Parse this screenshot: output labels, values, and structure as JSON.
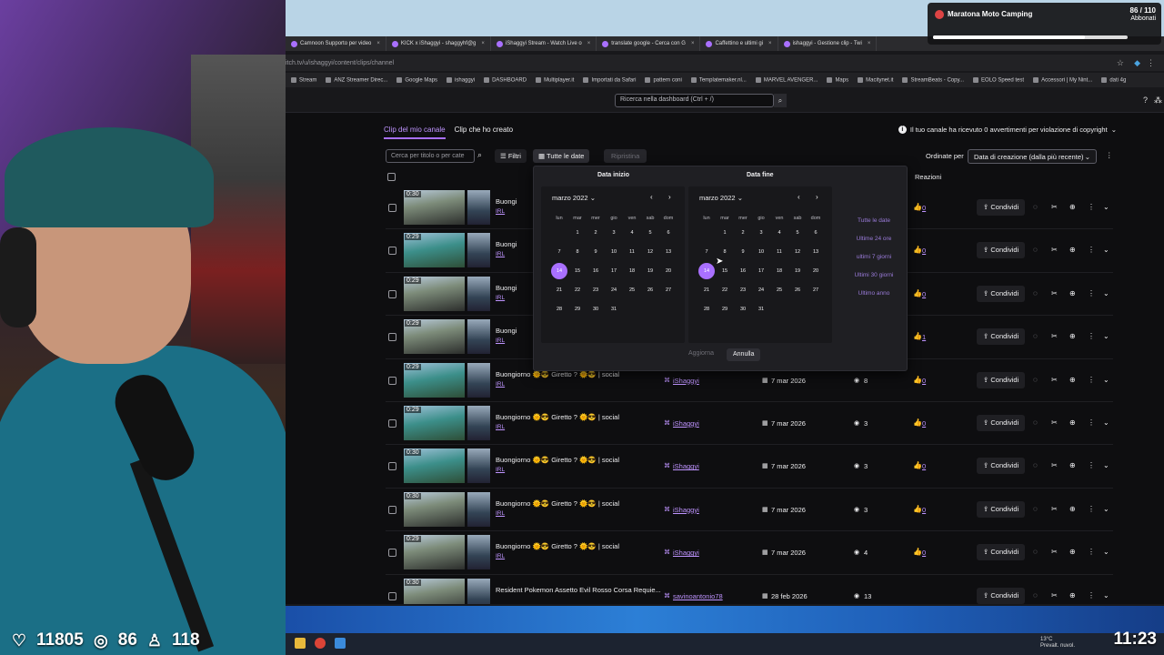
{
  "notification": {
    "title": "Maratona Moto Camping",
    "count": "86 / 110",
    "sub": "Abbonati",
    "progress": 0.78
  },
  "stats": {
    "hearts": "11805",
    "subs": "86",
    "followers": "118"
  },
  "tabs": [
    {
      "label": "Camnoon Supporto per video"
    },
    {
      "label": "KICK x iShaggyi - shaggyhf@g"
    },
    {
      "label": "iShaggyi Stream - Watch Live o"
    },
    {
      "label": "translate google - Cerca con G"
    },
    {
      "label": "Caffettino e ultimi gi"
    },
    {
      "label": "ishaggyi - Gestione clip - Twi"
    }
  ],
  "url": "itch.tv/u/ishaggyi/content/clips/channel",
  "bookmarks": [
    "Stream",
    "ANZ Streamer Direc...",
    "Google Maps",
    "ishaggyi",
    "DASHBOARD",
    "Multiplayer.it",
    "Importati da Safari",
    "pattern coni",
    "Templatemaker.nl...",
    "MARVEL AVENGER...",
    "Maps",
    "Macitynet.it",
    "StreamBeats - Copy...",
    "EOLO Speed test",
    "Accessori | My Nint...",
    "dati 4g"
  ],
  "dashboard_search_placeholder": "Ricerca nella dashboard (Ctrl + /)",
  "content_tabs": {
    "my_channel": "Clip del mio canale",
    "created": "Clip che ho creato"
  },
  "copyright_notice": "Il tuo canale ha ricevuto 0 avvertimenti per violazione di copyright",
  "filterbar": {
    "search_placeholder": "Cerca per titolo o per cate",
    "filters": "Filtri",
    "all_dates": "Tutte le date",
    "reset": "Ripristina",
    "sort_label": "Ordinate per",
    "sort_value": "Data di creazione (dalla più recente)"
  },
  "table_head": {
    "reactions": "Reazioni"
  },
  "rows": [
    {
      "duration": "0:30",
      "title": "Buongi",
      "category": "IRL",
      "author": "",
      "date": "",
      "views": "",
      "likes": "0",
      "share": "Condividi",
      "thumb": "road"
    },
    {
      "duration": "0:29",
      "title": "Buongi",
      "category": "IRL",
      "author": "",
      "date": "",
      "views": "",
      "likes": "0",
      "share": "Condividi",
      "thumb": "lake"
    },
    {
      "duration": "0:29",
      "title": "Buongi",
      "category": "IRL",
      "author": "",
      "date": "",
      "views": "",
      "likes": "0",
      "share": "Condividi",
      "thumb": "road"
    },
    {
      "duration": "0:29",
      "title": "Buongi",
      "category": "IRL",
      "author": "",
      "date": "",
      "views": "",
      "likes": "1",
      "share": "Condividi",
      "thumb": "road"
    },
    {
      "duration": "0:29",
      "title": "Buongiorno 🌞😎 Giretto ? 🌞😎 | social",
      "category": "IRL",
      "author": "iShaggyi",
      "date": "7 mar 2026",
      "views": "8",
      "likes": "0",
      "share": "Condividi",
      "thumb": "lake"
    },
    {
      "duration": "0:29",
      "title": "Buongiorno 🌞😎 Giretto ? 🌞😎 | social",
      "category": "IRL",
      "author": "iShaggyi",
      "date": "7 mar 2026",
      "views": "3",
      "likes": "0",
      "share": "Condividi",
      "thumb": "lake"
    },
    {
      "duration": "0:30",
      "title": "Buongiorno 🌞😎 Giretto ? 🌞😎 | social",
      "category": "IRL",
      "author": "iShaggyi",
      "date": "7 mar 2026",
      "views": "3",
      "likes": "0",
      "share": "Condividi",
      "thumb": "lake"
    },
    {
      "duration": "0:30",
      "title": "Buongiorno 🌞😎 Giretto ? 🌞😎 | social",
      "category": "IRL",
      "author": "iShaggyi",
      "date": "7 mar 2026",
      "views": "3",
      "likes": "0",
      "share": "Condividi",
      "thumb": "road"
    },
    {
      "duration": "0:29",
      "title": "Buongiorno 🌞😎 Giretto ? 🌞😎 | social",
      "category": "IRL",
      "author": "iShaggyi",
      "date": "7 mar 2026",
      "views": "4",
      "likes": "0",
      "share": "Condividi",
      "thumb": "road"
    },
    {
      "duration": "0:30",
      "title": "Resident Pokemon Assetto Evil Rosso Corsa Requie...",
      "category": "",
      "author": "savinoantonio78",
      "date": "28 feb 2026",
      "views": "13",
      "likes": "",
      "share": "Condividi",
      "thumb": "road"
    }
  ],
  "picker": {
    "start_label": "Data inizio",
    "end_label": "Data fine",
    "start_month": "marzo 2022",
    "end_month": "marzo 2022",
    "weekdays": [
      "lun",
      "mar",
      "mer",
      "gio",
      "ven",
      "sab",
      "dom"
    ],
    "weeks": [
      [
        "",
        "1",
        "2",
        "3",
        "4",
        "5",
        "6"
      ],
      [
        "7",
        "8",
        "9",
        "10",
        "11",
        "12",
        "13"
      ],
      [
        "14",
        "15",
        "16",
        "17",
        "18",
        "19",
        "20"
      ],
      [
        "21",
        "22",
        "23",
        "24",
        "25",
        "26",
        "27"
      ],
      [
        "28",
        "29",
        "30",
        "31",
        "",
        "",
        ""
      ]
    ],
    "selected_day": "14",
    "presets": [
      "Tutte le date",
      "Ultime 24 ore",
      "ultimi 7 giorni",
      "Ultimi 30 giorni",
      "Ultimo anno"
    ],
    "apply": "Aggiorna",
    "cancel": "Annulla"
  },
  "taskbar": {
    "temp": "13°C",
    "weather": "Prevalt. nuvol.",
    "clock": "11:23"
  },
  "colors": {
    "accent": "#a970ff",
    "link": "#bf94ff",
    "bg": "#0e0e10"
  }
}
